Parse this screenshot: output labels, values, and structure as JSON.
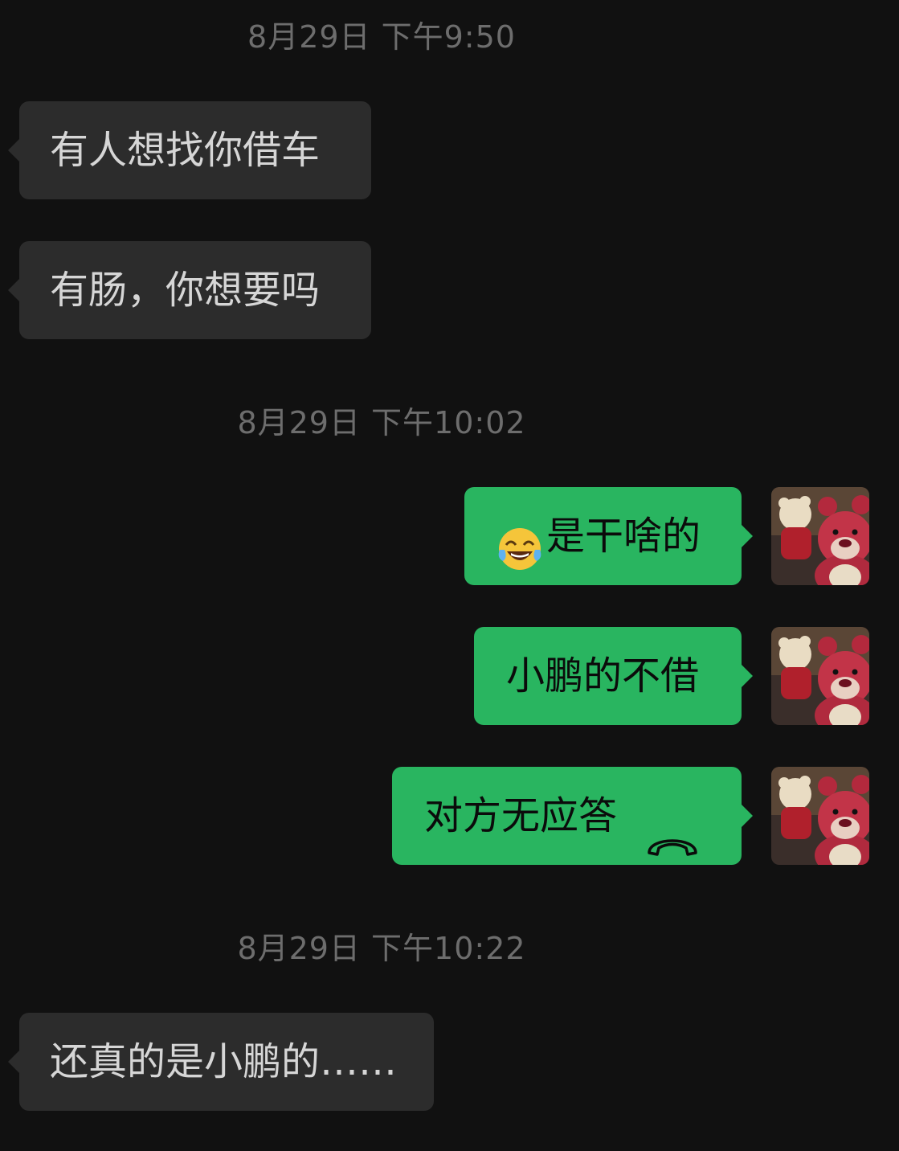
{
  "timestamps": [
    "8月29日 下午9:50",
    "8月29日 下午10:02",
    "8月29日 下午10:22"
  ],
  "messages": [
    {
      "direction": "incoming",
      "text": "有人想找你借车"
    },
    {
      "direction": "incoming",
      "text": "有肠，你想要吗"
    },
    {
      "direction": "outgoing",
      "emoji": "tears-of-joy-emoji",
      "text": "是干啥的"
    },
    {
      "direction": "outgoing",
      "text": "小鹏的不借"
    },
    {
      "direction": "outgoing",
      "text": "对方无应答",
      "icon": "hang-up-phone-icon"
    },
    {
      "direction": "incoming",
      "text": "还真的是小鹏的……"
    }
  ],
  "colors": {
    "background": "#111111",
    "incoming_bubble": "#2c2c2c",
    "outgoing_bubble": "#29b560",
    "timestamp_text": "#6d6d6d"
  },
  "avatar": {
    "icon": "pink-bear-avatar"
  }
}
